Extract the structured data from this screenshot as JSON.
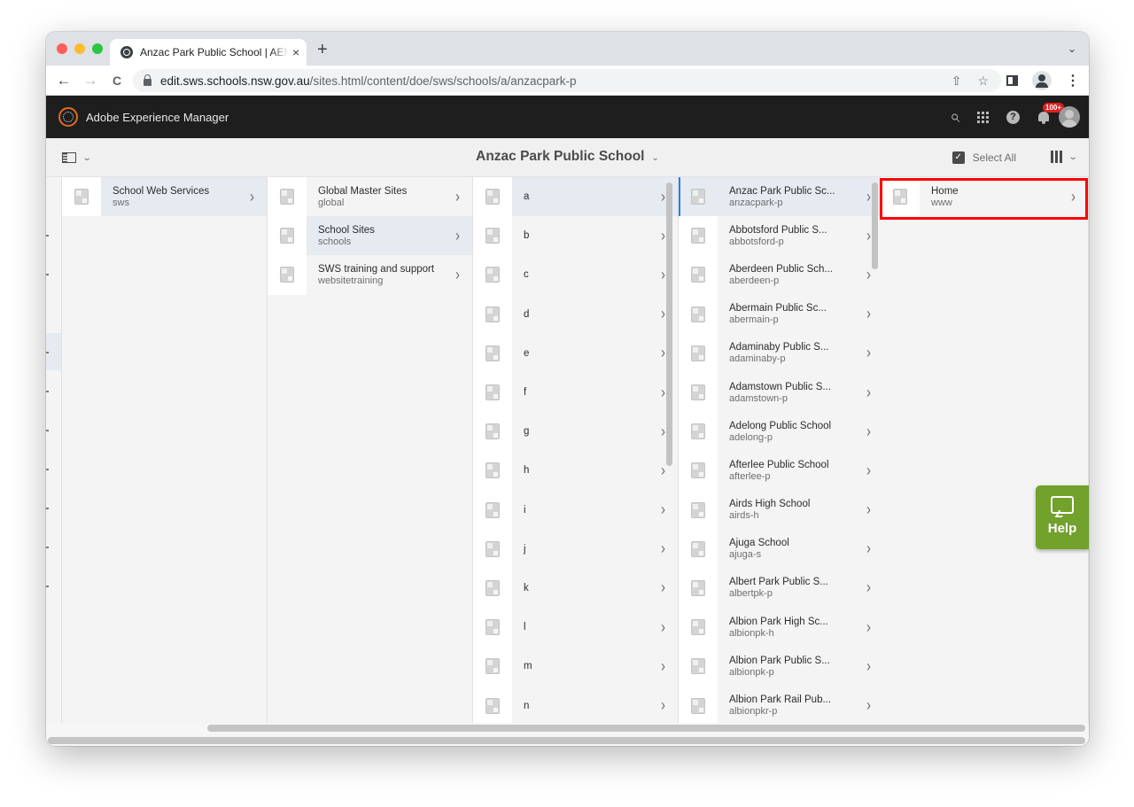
{
  "browser": {
    "tab_title": "Anzac Park Public School | AEM",
    "tab_close": "×",
    "new_tab": "+",
    "tab_menu": "⌄",
    "url_host": "edit.sws.schools.nsw.gov.au",
    "url_path": "/sites.html/content/doe/sws/schools/a/anzacpark-p",
    "back": "←",
    "forward": "→",
    "reload": "C",
    "share": "⇧",
    "star": "☆",
    "more": "⋮"
  },
  "aem": {
    "title": "Adobe Experience Manager",
    "search": "⌕",
    "help": "?",
    "notifications_badge": "100+",
    "brand_color": "#e26a1f"
  },
  "actionbar": {
    "rail_chevron": "⌄",
    "page_title": "Anzac Park Public School",
    "title_chevron": "⌄",
    "select_all": "Select All",
    "select_check": "✓",
    "view_chevron": "⌄"
  },
  "columns": [
    {
      "items": [
        {
          "title": "School Web Services",
          "name": "sws",
          "state": "active"
        }
      ]
    },
    {
      "items": [
        {
          "title": "Global Master Sites",
          "name": "global",
          "state": ""
        },
        {
          "title": "School Sites",
          "name": "schools",
          "state": "active"
        },
        {
          "title": "SWS training and support",
          "name": "websitetraining",
          "state": ""
        }
      ]
    },
    {
      "items": [
        {
          "title": "a",
          "state": "active"
        },
        {
          "title": "b"
        },
        {
          "title": "c"
        },
        {
          "title": "d"
        },
        {
          "title": "e"
        },
        {
          "title": "f"
        },
        {
          "title": "g"
        },
        {
          "title": "h"
        },
        {
          "title": "i"
        },
        {
          "title": "j"
        },
        {
          "title": "k"
        },
        {
          "title": "l"
        },
        {
          "title": "m"
        },
        {
          "title": "n"
        }
      ]
    },
    {
      "items": [
        {
          "title": "Anzac Park Public Sc...",
          "name": "anzacpark-p",
          "state": "selected"
        },
        {
          "title": "Abbotsford Public S...",
          "name": "abbotsford-p"
        },
        {
          "title": "Aberdeen Public Sch...",
          "name": "aberdeen-p"
        },
        {
          "title": "Abermain Public Sc...",
          "name": "abermain-p"
        },
        {
          "title": "Adaminaby Public S...",
          "name": "adaminaby-p"
        },
        {
          "title": "Adamstown Public S...",
          "name": "adamstown-p"
        },
        {
          "title": "Adelong Public School",
          "name": "adelong-p"
        },
        {
          "title": "Afterlee Public School",
          "name": "afterlee-p"
        },
        {
          "title": "Airds High School",
          "name": "airds-h"
        },
        {
          "title": "Ajuga School",
          "name": "ajuga-s"
        },
        {
          "title": "Albert Park Public S...",
          "name": "albertpk-p"
        },
        {
          "title": "Albion Park High Sc...",
          "name": "albionpk-h"
        },
        {
          "title": "Albion Park Public S...",
          "name": "albionpk-p"
        },
        {
          "title": "Albion Park Rail Pub...",
          "name": "albionpkr-p"
        }
      ]
    },
    {
      "items": [
        {
          "title": "Home",
          "name": "www",
          "state": "highlighted"
        }
      ]
    }
  ],
  "chevron": "›",
  "help_widget": {
    "label": "Help",
    "color": "#72a12c"
  },
  "highlight_color": "#ff0000"
}
